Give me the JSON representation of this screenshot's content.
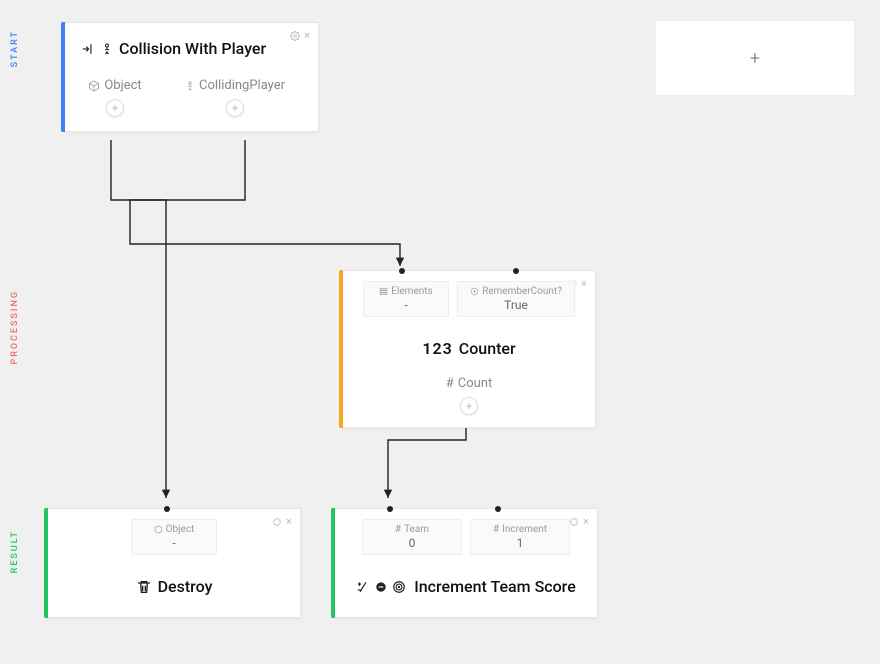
{
  "rails": {
    "start": "START",
    "processing": "PROCESSING",
    "result": "RESULT"
  },
  "nodes": {
    "collision": {
      "title": "Collision With Player",
      "outputs": {
        "object": "Object",
        "colliding": "CollidingPlayer"
      }
    },
    "counter": {
      "title": "Counter",
      "title_prefix": "123",
      "inputs": {
        "elements": {
          "label": "Elements",
          "value": "-"
        },
        "remember": {
          "label": "RememberCount?",
          "value": "True"
        }
      },
      "output": {
        "label": "Count"
      }
    },
    "destroy": {
      "title": "Destroy",
      "inputs": {
        "object": {
          "label": "Object",
          "value": "-"
        }
      }
    },
    "increment": {
      "title": "Increment Team Score",
      "inputs": {
        "team": {
          "label": "Team",
          "value": "0"
        },
        "increment": {
          "label": "Increment",
          "value": "1"
        }
      }
    }
  },
  "plus_card": "+",
  "glyphs": {
    "plus": "+",
    "close": "×",
    "hash": "#"
  }
}
